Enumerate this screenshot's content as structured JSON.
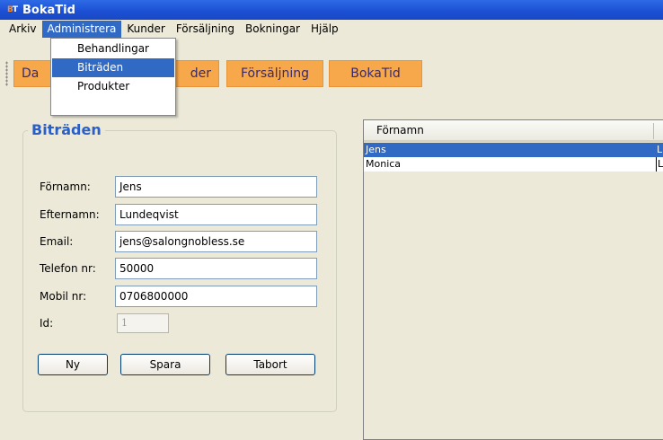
{
  "window": {
    "title": "BokaTid",
    "icon_text_a": "B",
    "icon_text_b": "T"
  },
  "menubar": {
    "items": [
      "Arkiv",
      "Administrera",
      "Kunder",
      "Försäljning",
      "Bokningar",
      "Hjälp"
    ],
    "active_index": 1
  },
  "dropdown": {
    "items": [
      "Behandlingar",
      "Biträden",
      "Produkter"
    ],
    "selected_index": 1
  },
  "toolbar": {
    "buttons": [
      "Da",
      "der",
      "Försäljning",
      "BokaTid"
    ]
  },
  "form": {
    "title": "Biträden",
    "fields": [
      {
        "label": "Förnamn:",
        "value": "Jens"
      },
      {
        "label": "Efternamn:",
        "value": "Lundeqvist"
      },
      {
        "label": "Email:",
        "value": "jens@salongnobless.se"
      },
      {
        "label": "Telefon nr:",
        "value": "50000"
      },
      {
        "label": "Mobil nr:",
        "value": "0706800000"
      }
    ],
    "id_label": "Id:",
    "id_value": "1",
    "buttons": {
      "new": "Ny",
      "save": "Spara",
      "delete": "Tabort"
    }
  },
  "table": {
    "header": "Förnamn",
    "rows": [
      {
        "first": "Jens",
        "second": "L",
        "selected": true
      },
      {
        "first": "Monica",
        "second": "L",
        "selected": false
      }
    ]
  },
  "colors": {
    "title_bar": "#1b4fd3",
    "selection": "#316ac5",
    "toolbar_button": "#f7a84a",
    "group_title": "#2b5fc8"
  }
}
